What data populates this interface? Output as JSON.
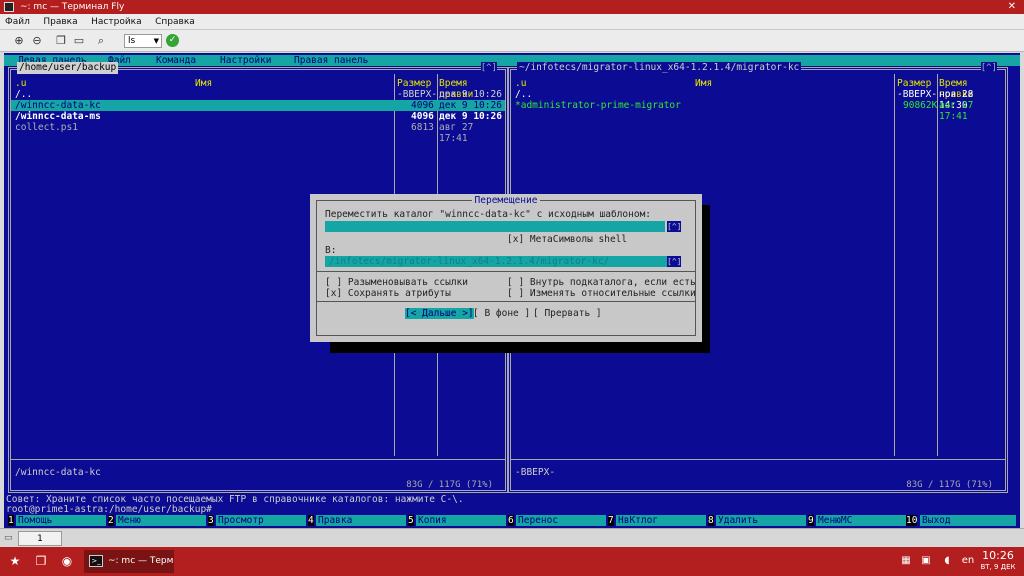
{
  "window": {
    "title": "~: mc — Терминал Fly",
    "close": "✕"
  },
  "menubar": [
    "Файл",
    "Правка",
    "Настройка",
    "Справка"
  ],
  "toolbar": {
    "command_value": "ls"
  },
  "mc": {
    "top_menu": [
      "Левая панель",
      "Файл",
      "Команда",
      "Настройки",
      "Правая панель"
    ],
    "left": {
      "path": "/home/user/backup",
      "corner": "[^]",
      "headers": [
        ".u",
        "Имя",
        "Размер",
        "Время правки"
      ],
      "rows": [
        {
          "name": "/..",
          "size": "-ВВЕРХ-",
          "time": "дек  9 10:26",
          "sel": false
        },
        {
          "name": "/winncc-data-kc",
          "size": "4096",
          "time": "дек  9 10:26",
          "sel": true
        },
        {
          "name": "/winncc-data-ms",
          "size": "4096",
          "time": "дек  9 10:26",
          "sel": false
        },
        {
          "name": " collect.ps1",
          "size": "6813",
          "time": "авг 27 17:41",
          "sel": false
        }
      ],
      "status": "/winncc-data-kc",
      "free": "83G / 117G (71%)"
    },
    "right": {
      "path": "~/infotecs/migrator-linux_x64-1.2.1.4/migrator-kc",
      "corner": "[^]",
      "headers": [
        ".u",
        "Имя",
        "Размер",
        "Время правки"
      ],
      "rows": [
        {
          "name": "/..",
          "size": "-ВВЕРХ-",
          "time": "ноя 28 14:30",
          "sel": false
        },
        {
          "name": "*administrator-prime-migrator",
          "size": "90862K",
          "time": "авг 27 17:41",
          "sel": false
        }
      ],
      "status": "-ВВЕРХ-",
      "free": "83G / 117G (71%)"
    },
    "dialog": {
      "title": "Перемещение",
      "prompt": "Переместить каталог \"winncc-data-kc\" с исходным шаблоном:",
      "input1_arrow": "[^]",
      "shell_opt": "[x] МетаСимволы shell",
      "to_label": "В:",
      "input2_value": "/infotecs/migrator-linux_x64-1.2.1.4/migrator-kc/",
      "input2_arrow": "[^]",
      "opt_deref": "[ ] Разыменовывать ссылки",
      "opt_save": "[x] Сохранять атрибуты",
      "opt_inside": "[ ] Внутрь подкаталога, если есть",
      "opt_relative": "[ ] Изменять относительные ссылки",
      "btn_next": "[< Дальше >]",
      "btn_bg": "[ В фоне ]",
      "btn_abort": "[ Прервать ]"
    },
    "hint": "Совет: Храните список часто посещаемых FTP в справочнике каталогов: нажмите C-\\.",
    "prompt": "root@prime1-astra:/home/user/backup#",
    "fkeys": [
      {
        "n": "1",
        "label": "Помощь"
      },
      {
        "n": "2",
        "label": "Меню"
      },
      {
        "n": "3",
        "label": "Просмотр"
      },
      {
        "n": "4",
        "label": "Правка"
      },
      {
        "n": "5",
        "label": "Копия"
      },
      {
        "n": "6",
        "label": "Перенос"
      },
      {
        "n": "7",
        "label": "НвКтлог"
      },
      {
        "n": "8",
        "label": "Удалить"
      },
      {
        "n": "9",
        "label": "МенюМС"
      },
      {
        "n": "10",
        "label": "Выход"
      }
    ]
  },
  "tabs": {
    "tab1": "1"
  },
  "taskbar": {
    "task_label": "~: mc — Термина...",
    "lang": "en",
    "time": "10:26",
    "date": "ВТ, 9 ДЕК"
  }
}
